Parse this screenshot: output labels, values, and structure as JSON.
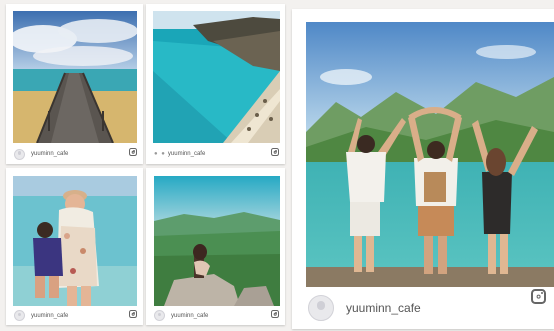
{
  "posts": [
    {
      "username": "yuuminn_cafe",
      "photo": "pier-over-ocean",
      "icon": "instagram-icon"
    },
    {
      "username": "yuuminn_cafe",
      "photo": "turquoise-beach-cliffs",
      "icon": "instagram-icon",
      "prefix": "● ●"
    },
    {
      "username": "yuuminn_cafe",
      "photo": "mother-daughter-beach",
      "icon": "instagram-icon"
    },
    {
      "username": "yuuminn_cafe",
      "photo": "woman-on-mountain-rock",
      "icon": "instagram-icon"
    }
  ],
  "featured": {
    "username": "yuuminn_cafe",
    "photo": "three-friends-at-lake",
    "icon": "instagram-icon"
  },
  "colors": {
    "card": "#ffffff",
    "background": "#f3f1ef",
    "username": "#555555"
  }
}
